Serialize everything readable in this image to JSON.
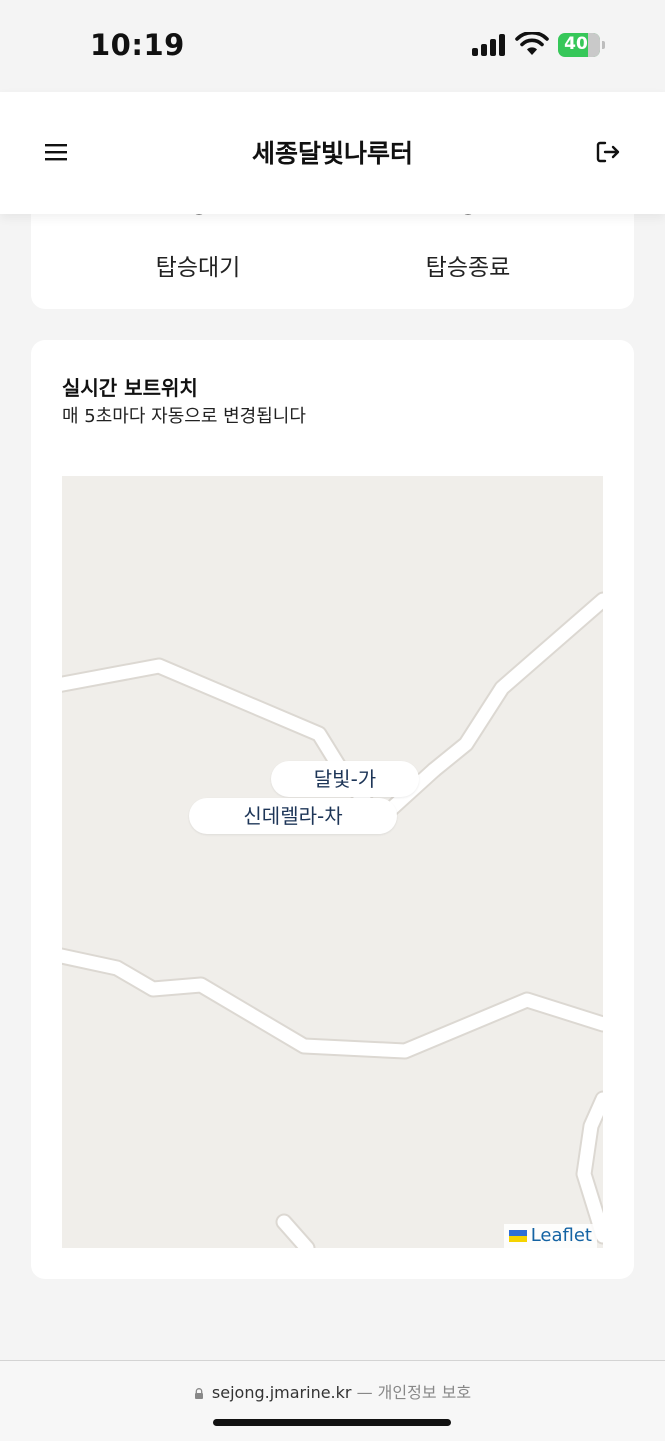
{
  "status_bar": {
    "time": "10:19",
    "battery": "40"
  },
  "header": {
    "title": "세종달빛나루터"
  },
  "status_card": {
    "items": [
      {
        "label": "탑승대기"
      },
      {
        "label": "탑승종료"
      }
    ]
  },
  "map_section": {
    "title": "실시간 보트위치",
    "subtitle": "매 5초마다 자동으로 변경됩니다",
    "boats": [
      {
        "name": "달빛-가"
      },
      {
        "name": "신데렐라-차"
      }
    ],
    "attribution": "Leaflet"
  },
  "browser": {
    "url": "sejong.jmarine.kr",
    "separator": "—",
    "privacy_label": "개인정보 보호"
  },
  "colors": {
    "map_background": "#f0eeea",
    "road": "#ffffff",
    "boat_label_text": "#1d3557",
    "battery_green": "#36c759"
  }
}
